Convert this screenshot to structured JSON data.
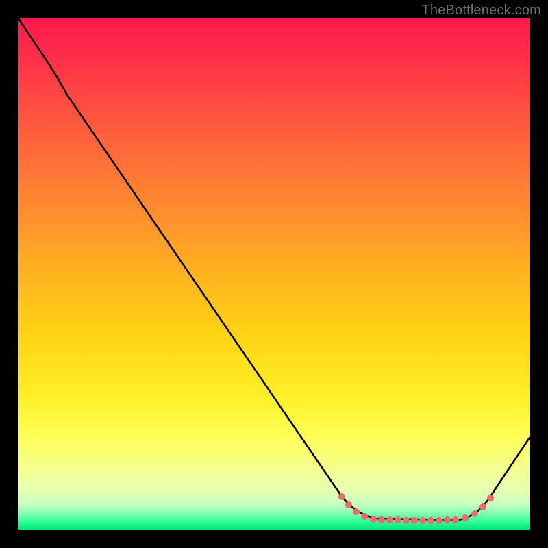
{
  "watermark": "TheBottleneck.com",
  "chart_data": {
    "type": "line",
    "title": "",
    "xlabel": "",
    "ylabel": "",
    "xlim": [
      0,
      100
    ],
    "ylim": [
      0,
      100
    ],
    "background": "heat-gradient (red→orange→yellow→green, top→bottom)",
    "series": [
      {
        "name": "bottleneck-curve",
        "x": [
          0,
          5,
          10,
          63,
          70,
          75,
          86,
          90,
          93,
          100
        ],
        "values": [
          100,
          92,
          85,
          7,
          3,
          1.5,
          1.5,
          3,
          6,
          18
        ]
      }
    ],
    "annotations": [
      {
        "name": "optimal-range-markers",
        "style": "coral-dots",
        "x_range": [
          63,
          92
        ],
        "color": "#ef6a6a"
      }
    ],
    "grid": false,
    "legend": false
  }
}
